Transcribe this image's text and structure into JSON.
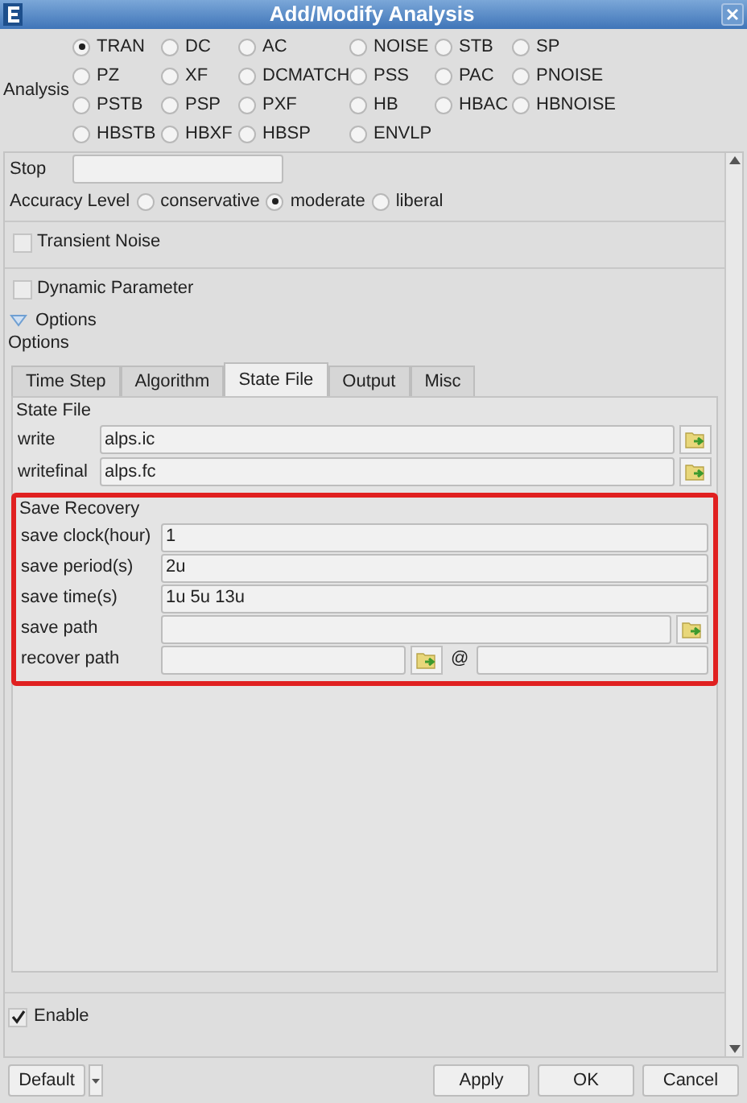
{
  "window": {
    "title": "Add/Modify Analysis"
  },
  "analysis": {
    "label": "Analysis",
    "options": [
      {
        "label": "TRAN",
        "selected": true
      },
      {
        "label": "DC",
        "selected": false
      },
      {
        "label": "AC",
        "selected": false
      },
      {
        "label": "NOISE",
        "selected": false
      },
      {
        "label": "STB",
        "selected": false
      },
      {
        "label": "SP",
        "selected": false
      },
      {
        "label": "PZ",
        "selected": false
      },
      {
        "label": "XF",
        "selected": false
      },
      {
        "label": "DCMATCH",
        "selected": false
      },
      {
        "label": "PSS",
        "selected": false
      },
      {
        "label": "PAC",
        "selected": false
      },
      {
        "label": "PNOISE",
        "selected": false
      },
      {
        "label": "PSTB",
        "selected": false
      },
      {
        "label": "PSP",
        "selected": false
      },
      {
        "label": "PXF",
        "selected": false
      },
      {
        "label": "HB",
        "selected": false
      },
      {
        "label": "HBAC",
        "selected": false
      },
      {
        "label": "HBNOISE",
        "selected": false
      },
      {
        "label": "HBSTB",
        "selected": false
      },
      {
        "label": "HBXF",
        "selected": false
      },
      {
        "label": "HBSP",
        "selected": false
      },
      {
        "label": "ENVLP",
        "selected": false
      }
    ]
  },
  "stop": {
    "label": "Stop"
  },
  "accuracy": {
    "label": "Accuracy Level",
    "options": [
      {
        "label": "conservative",
        "selected": false
      },
      {
        "label": "moderate",
        "selected": true
      },
      {
        "label": "liberal",
        "selected": false
      }
    ]
  },
  "transient_noise": {
    "label": "Transient Noise",
    "checked": false
  },
  "dynamic_parameter": {
    "label": "Dynamic Parameter",
    "checked": false
  },
  "options": {
    "toggle_label": "Options",
    "expanded": true,
    "label": "Options",
    "tabs": [
      {
        "label": "Time Step",
        "selected": false
      },
      {
        "label": "Algorithm",
        "selected": false
      },
      {
        "label": "State File",
        "selected": true
      },
      {
        "label": "Output",
        "selected": false
      },
      {
        "label": "Misc",
        "selected": false
      }
    ],
    "state_file": {
      "title": "State File",
      "rows": [
        {
          "label": "write",
          "value": "alps.ic"
        },
        {
          "label": "writefinal",
          "value": "alps.fc"
        }
      ]
    },
    "save_recovery": {
      "title": "Save Recovery",
      "highlighted": true,
      "rows": [
        {
          "kind": "text",
          "label": "save clock(hour)",
          "value": "1"
        },
        {
          "kind": "text",
          "label": "save period(s)",
          "value": "2u"
        },
        {
          "kind": "text",
          "label": "save time(s)",
          "value": "1u 5u 13u"
        },
        {
          "kind": "browse",
          "label": "save path"
        },
        {
          "kind": "recover",
          "label": "recover path",
          "at": "@"
        }
      ]
    }
  },
  "enable": {
    "label": "Enable",
    "checked": true
  },
  "buttons": {
    "default": "Default",
    "actions": [
      {
        "label": "Apply"
      },
      {
        "label": "OK"
      },
      {
        "label": "Cancel"
      }
    ]
  }
}
